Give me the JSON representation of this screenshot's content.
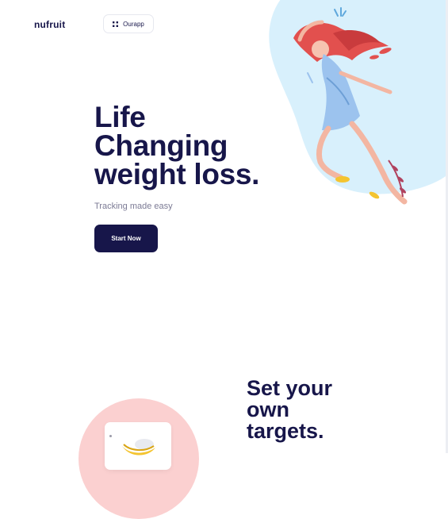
{
  "header": {
    "brand": "nufruit",
    "app_link_label": "Ourapp"
  },
  "hero": {
    "headline_lines": [
      "Life",
      "Changing",
      "weight loss."
    ],
    "subtitle": "Tracking made easy",
    "cta_label": "Start Now"
  },
  "targets_section": {
    "title_lines": [
      "Set your",
      "own",
      "targets."
    ]
  },
  "colors": {
    "navy": "#17164a",
    "blob_blue": "#d8f0fc",
    "pink": "#fbd0d0",
    "hair": "#e2504e",
    "banana": "#f4c430"
  },
  "icons": [
    "grid-icon",
    "banana-icon"
  ]
}
